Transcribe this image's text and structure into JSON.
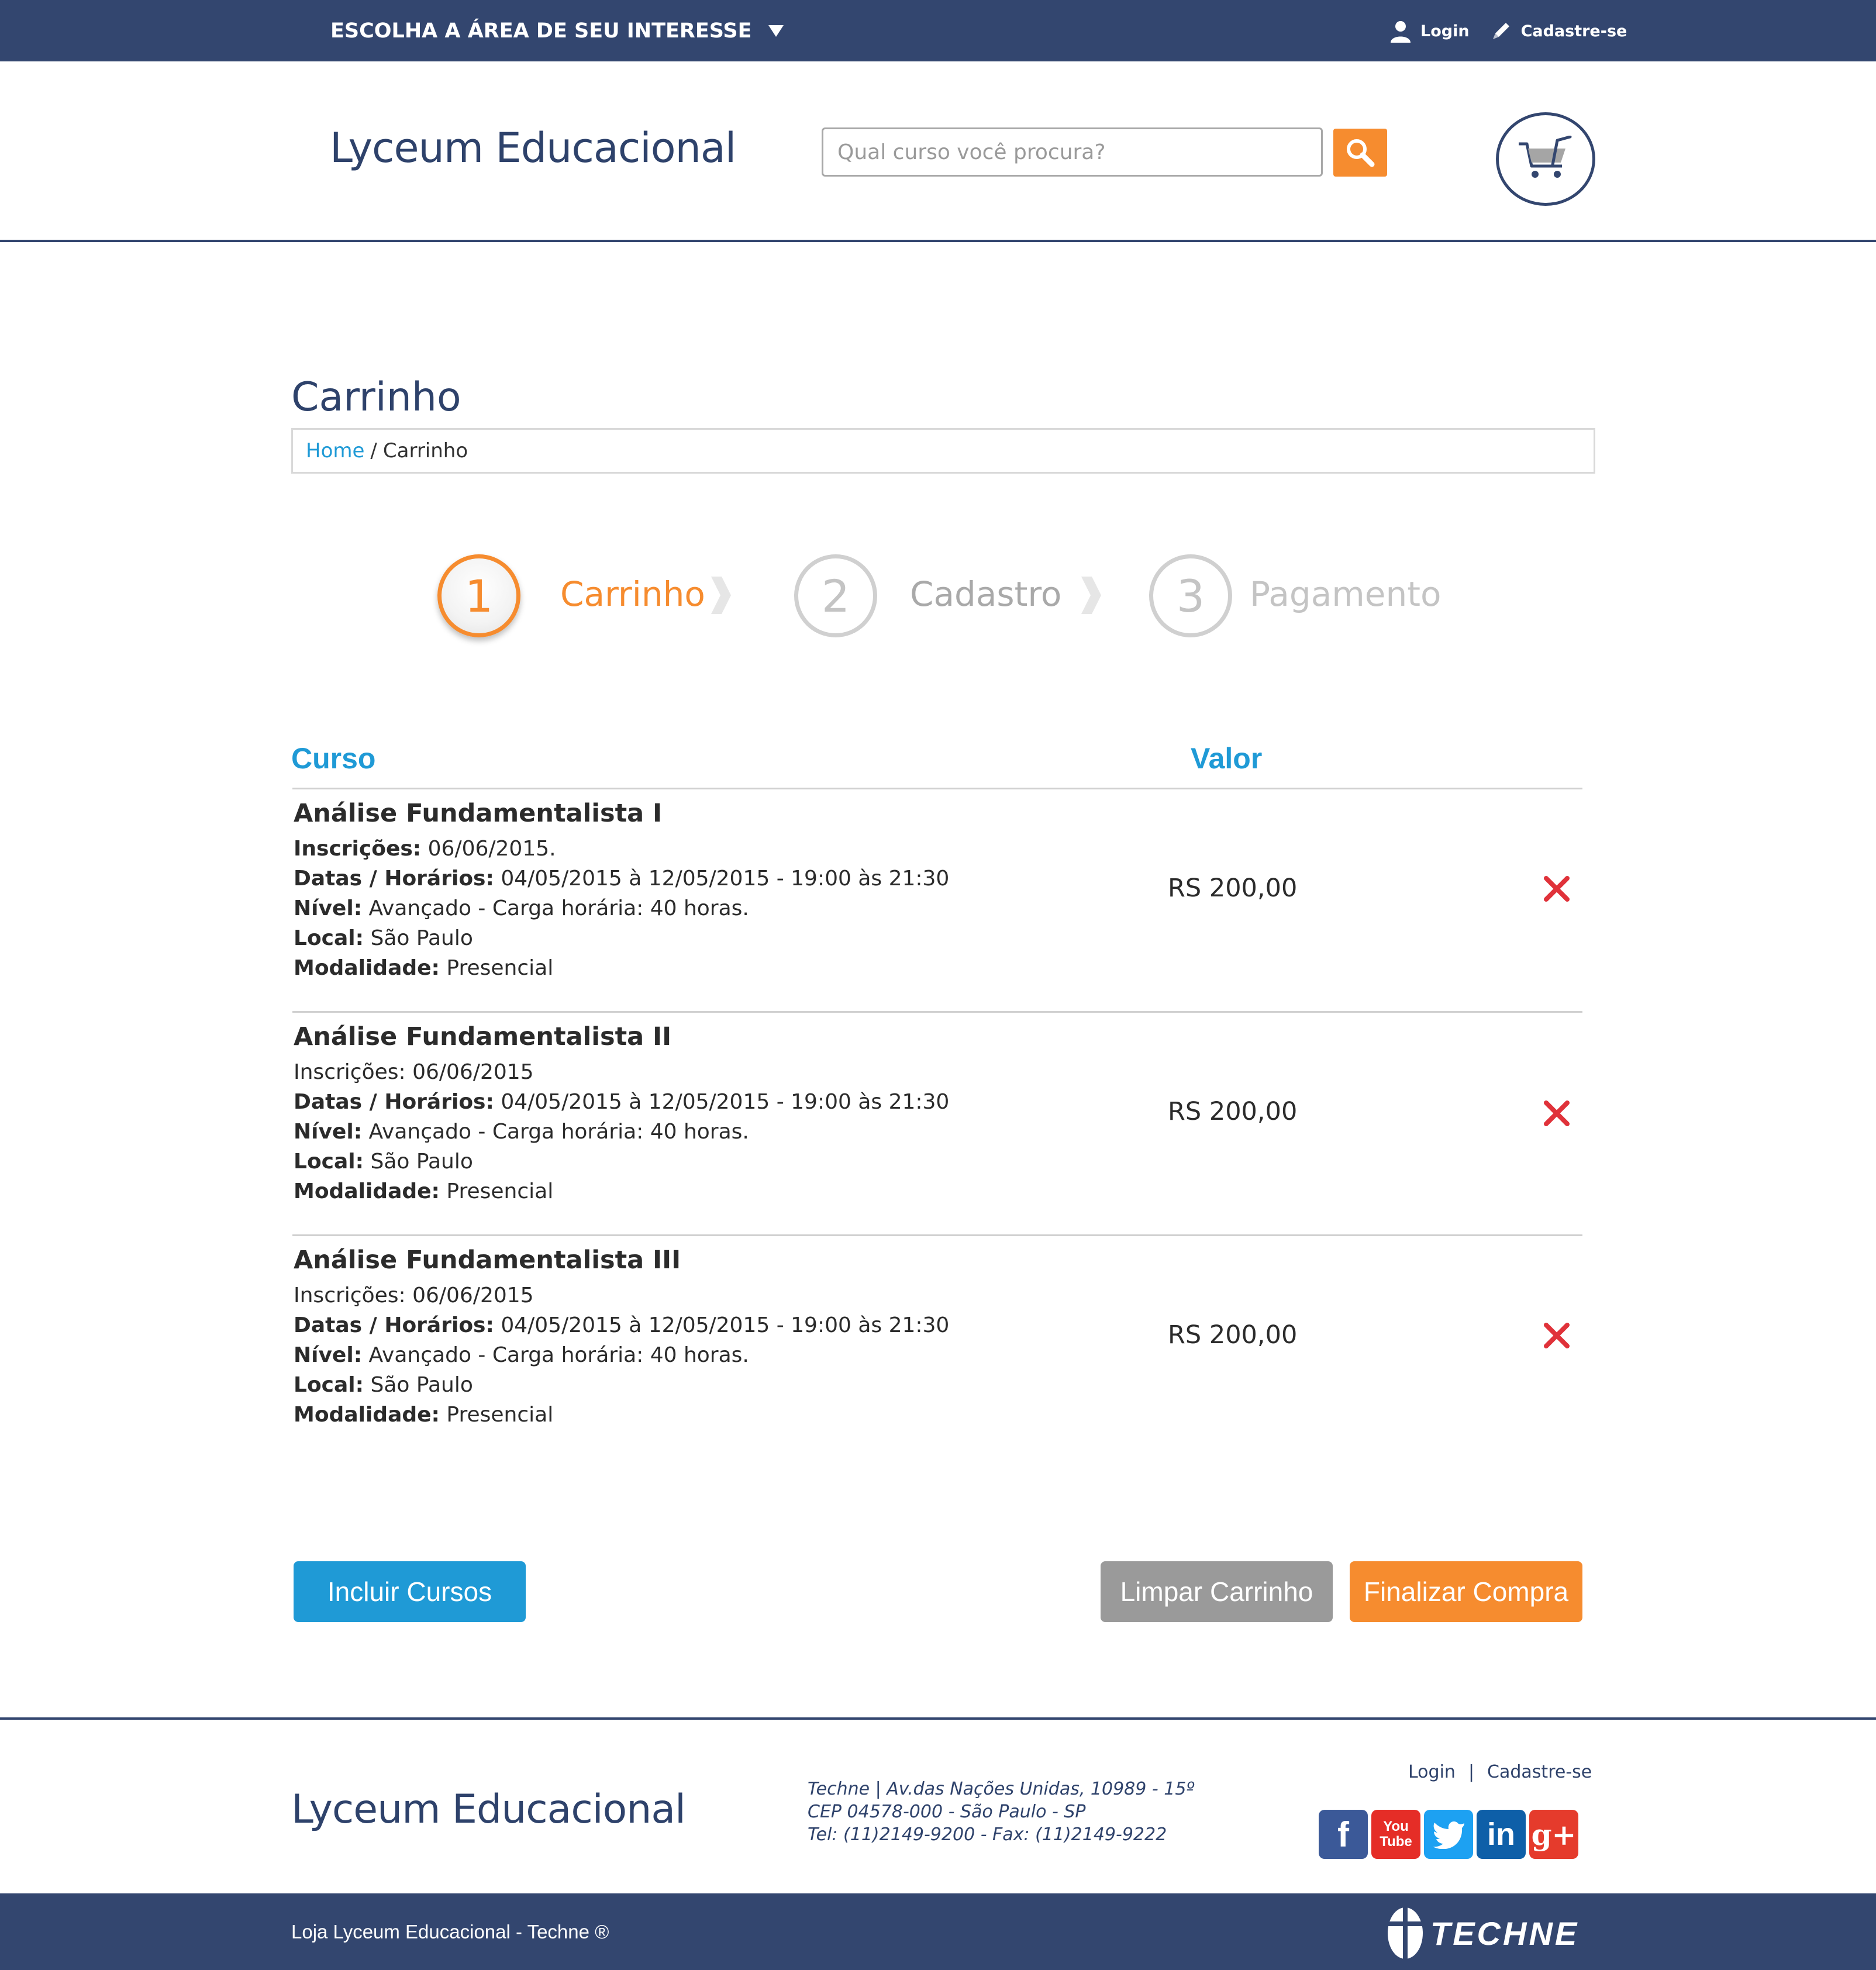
{
  "topbar": {
    "area_label": "ESCOLHA A ÁREA DE SEU INTERESSE",
    "login_label": "Login",
    "register_label": "Cadastre-se"
  },
  "header": {
    "logo": "Lyceum Educacional",
    "search_placeholder": "Qual curso você procura?"
  },
  "page": {
    "title": "Carrinho",
    "breadcrumb": {
      "home": "Home",
      "separator": "/",
      "current": "Carrinho"
    }
  },
  "steps": [
    {
      "number": "1",
      "label": "Carrinho"
    },
    {
      "number": "2",
      "label": "Cadastro"
    },
    {
      "number": "3",
      "label": "Pagamento"
    }
  ],
  "table": {
    "col_course": "Curso",
    "col_value": "Valor",
    "items": [
      {
        "title": "Análise Fundamentalista I",
        "inscricoes_label": "Inscrições:",
        "inscricoes_value": " 06/06/2015.",
        "datas_label": "Datas / Horários:",
        "datas_value": " 04/05/2015 à 12/05/2015 - 19:00 às 21:30",
        "nivel_label": "Nível:",
        "nivel_value": " Avançado - Carga horária: 40 horas.",
        "local_label": "Local:",
        "local_value": " São Paulo",
        "modalidade_label": "Modalidade:",
        "modalidade_value": " Presencial",
        "price": "RS 200,00"
      },
      {
        "title": "Análise Fundamentalista II",
        "inscricoes_text": "Inscrições: 06/06/2015",
        "datas_label": "Datas / Horários:",
        "datas_value": " 04/05/2015 à 12/05/2015 - 19:00 às 21:30",
        "nivel_label": "Nível:",
        "nivel_value": " Avançado - Carga horária: 40 horas.",
        "local_label": "Local:",
        "local_value": " São Paulo",
        "modalidade_label": "Modalidade:",
        "modalidade_value": " Presencial",
        "price": "RS 200,00"
      },
      {
        "title": "Análise Fundamentalista III",
        "inscricoes_text": "Inscrições: 06/06/2015",
        "datas_label": "Datas / Horários:",
        "datas_value": " 04/05/2015 à 12/05/2015 - 19:00 às 21:30",
        "nivel_label": "Nível:",
        "nivel_value": " Avançado - Carga horária: 40 horas.",
        "local_label": "Local:",
        "local_value": " São Paulo",
        "modalidade_label": "Modalidade:",
        "modalidade_value": " Presencial",
        "price": "RS 200,00"
      }
    ]
  },
  "buttons": {
    "incluir": "Incluir Cursos",
    "limpar": "Limpar Carrinho",
    "finalizar": "Finalizar Compra"
  },
  "footer": {
    "logo": "Lyceum Educacional",
    "address_line1": "Techne | Av.das Nações Unidas, 10989 - 15º",
    "address_line2": "CEP 04578-000 - São Paulo - SP",
    "address_line3": "Tel: (11)2149-9200 - Fax: (11)2149-9222",
    "login": "Login",
    "separator": "|",
    "register": "Cadastre-se",
    "socials": [
      {
        "name": "facebook-icon",
        "glyph": "f",
        "color": "#3b5998"
      },
      {
        "name": "youtube-icon",
        "glyph": "You Tube",
        "color": "#e52d27"
      },
      {
        "name": "twitter-icon",
        "glyph": "t",
        "color": "#1da1f2"
      },
      {
        "name": "linkedin-icon",
        "glyph": "in",
        "color": "#0e5fa8"
      },
      {
        "name": "googleplus-icon",
        "glyph": "g+",
        "color": "#e53b2c"
      }
    ],
    "bottom_text": "Loja Lyceum Educacional - Techne ®",
    "brand": "TECHNE"
  },
  "colors": {
    "navy": "#33466f",
    "orange": "#f68c2f",
    "blue": "#1f9ad6",
    "gray_button": "#9a9a9a",
    "remove_red": "#e0323a"
  }
}
